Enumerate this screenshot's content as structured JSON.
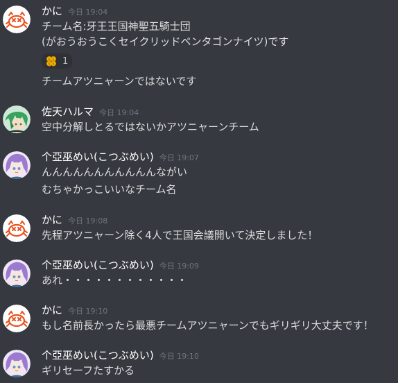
{
  "messages": [
    {
      "username": "かに",
      "timestamp": "今日 19:04",
      "avatar_icon": "crab-avatar-icon",
      "lines": [
        "チーム名:牙王王国神聖五騎士団",
        "(がおうおうこくセイクリッドペンタゴンナイツ)です"
      ],
      "reaction": {
        "emoji": "money-bag-emoji-icon",
        "count": "1"
      },
      "after_lines": [
        "チームアツニャーンではないです"
      ]
    },
    {
      "username": "佐天ハルマ",
      "timestamp": "今日 19:04",
      "avatar_icon": "green-hair-character-avatar-icon",
      "lines": [
        "空中分解しとるではないかアツニャーンチーム"
      ]
    },
    {
      "username": "个亞巫めい(こつぶめい)",
      "timestamp": "今日 19:07",
      "avatar_icon": "purple-hair-character-avatar-icon",
      "lines": [
        "んんんんんんんんんんんながい",
        "むちゃかっこいいなチーム名"
      ]
    },
    {
      "username": "かに",
      "timestamp": "今日 19:08",
      "avatar_icon": "crab-avatar-icon",
      "lines": [
        "先程アツニャーン除く4人で王国会議開いて決定しました！"
      ]
    },
    {
      "username": "个亞巫めい(こつぶめい)",
      "timestamp": "今日 19:09",
      "avatar_icon": "purple-hair-character-avatar-icon",
      "lines": [
        "あれ・・・・・・・・・・・・"
      ]
    },
    {
      "username": "かに",
      "timestamp": "今日 19:10",
      "avatar_icon": "crab-avatar-icon",
      "lines": [
        "もし名前長かったら最悪チームアツニャーンでもギリギリ大丈夫です！"
      ]
    },
    {
      "username": "个亞巫めい(こつぶめい)",
      "timestamp": "今日 19:10",
      "avatar_icon": "purple-hair-character-avatar-icon",
      "lines": [
        "ギリセーフたすかる"
      ]
    }
  ],
  "colors": {
    "background": "#36393f",
    "username": "#ffffff",
    "timestamp": "#72767d",
    "text": "#dcddde",
    "reaction_bg": "#2f3136"
  }
}
